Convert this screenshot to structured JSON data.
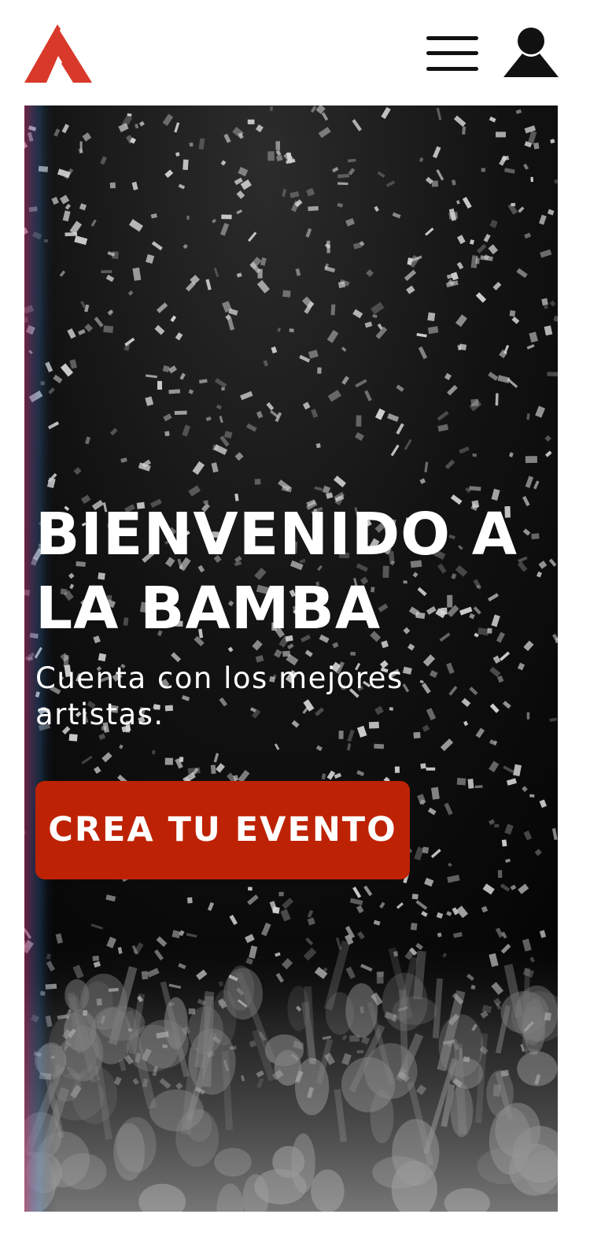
{
  "header": {
    "logo_icon": "la-bamba-logo-icon",
    "logo_color": "#d9392a",
    "menu_icon": "hamburger-menu-icon",
    "user_icon": "user-account-icon"
  },
  "hero": {
    "title": "BIENVENIDO A\nLA BAMBA",
    "subtitle": "Cuenta con los mejores artistas.",
    "cta_label": "CREA TU EVENTO",
    "cta_color": "#be2204",
    "background_image": "concert crowd under falling confetti (black and white photo)"
  }
}
